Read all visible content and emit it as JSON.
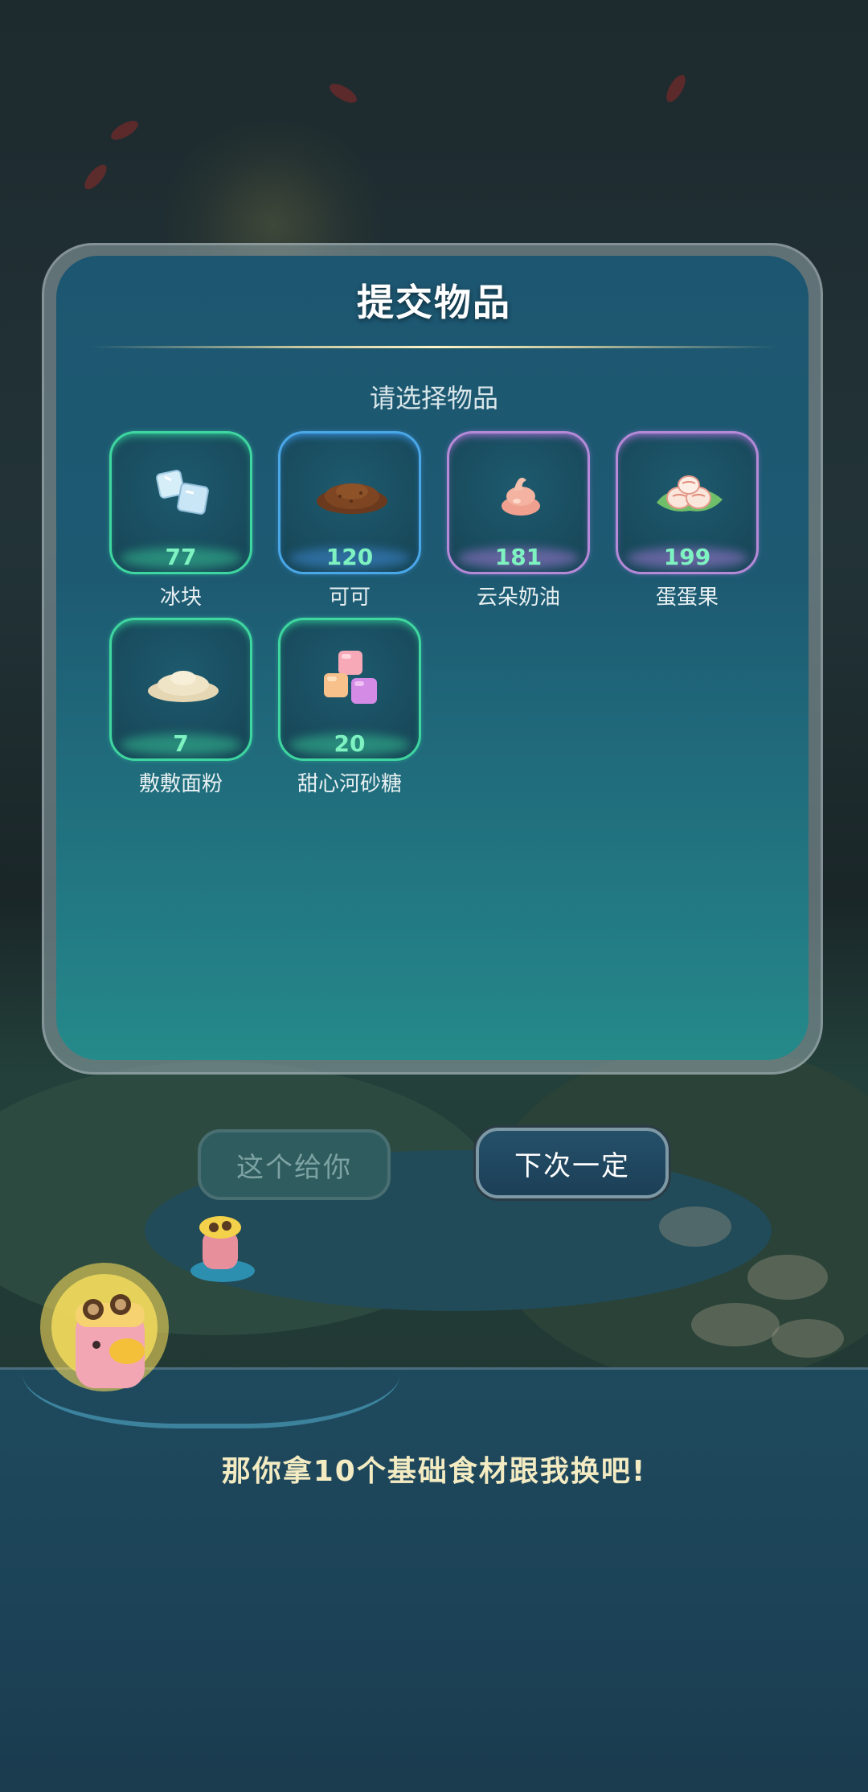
{
  "panel": {
    "title": "提交物品",
    "subtitle": "请选择物品"
  },
  "items": [
    {
      "name": "冰块",
      "count": "77",
      "icon": "ice-cube-icon",
      "rarity_color": "#3fd6a0"
    },
    {
      "name": "可可",
      "count": "120",
      "icon": "cocoa-powder-icon",
      "rarity_color": "#4aa8e8"
    },
    {
      "name": "云朵奶油",
      "count": "181",
      "icon": "cream-icon",
      "rarity_color": "#b58ad8"
    },
    {
      "name": "蛋蛋果",
      "count": "199",
      "icon": "egg-fruit-icon",
      "rarity_color": "#b58ad8"
    },
    {
      "name": "敷敷面粉",
      "count": "7",
      "icon": "flour-icon",
      "rarity_color": "#3fd6a0"
    },
    {
      "name": "甜心河砂糖",
      "count": "20",
      "icon": "sugar-cubes-icon",
      "rarity_color": "#3fd6a0"
    }
  ],
  "buttons": {
    "give": "这个给你",
    "next_time": "下次一定"
  },
  "dialog": {
    "text": "那你拿10个基础食材跟我换吧!"
  }
}
